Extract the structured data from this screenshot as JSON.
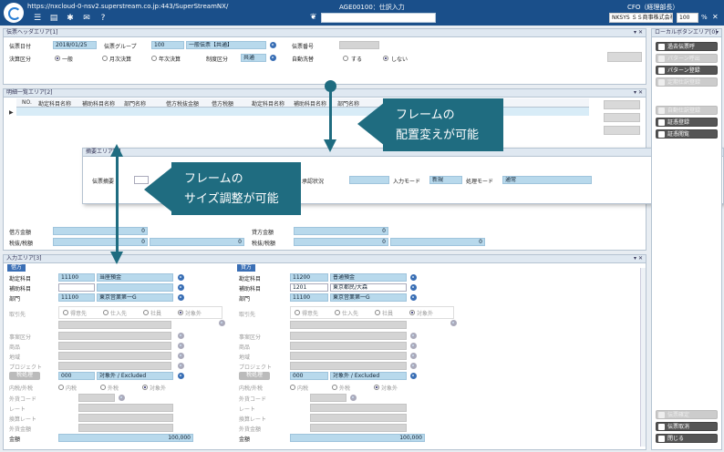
{
  "topbar": {
    "url": "https://nxcloud-0-nsv2.superstream.co.jp:443/SuperStreamNX/",
    "screen_title": "AGE00100：仕訳入力",
    "cfo": "CFO（経理部長）",
    "company": "NKSYS ＳＳ商事株式会社",
    "zoom": "100",
    "pct": "%"
  },
  "header_panel": {
    "title": "伝票ヘッダエリア[1]",
    "date_label": "伝票日付",
    "date_value": "2018/01/25",
    "group_label": "伝票グループ",
    "group_code": "100",
    "group_name": "一般伝票【共通】",
    "slip_no_label": "伝票番号",
    "settle_label": "決算区分",
    "settle_opt1": "一般",
    "settle_opt2": "月次決算",
    "settle_opt3": "年次決算",
    "system_label": "制度区分",
    "system_value": "共通",
    "auto_label": "自動洗替",
    "auto_yes": "する",
    "auto_no": "しない"
  },
  "detail_panel": {
    "title": "明細一覧エリア[2]",
    "columns": [
      "NO.",
      "勘定科目名称",
      "補助科目名称",
      "部門名称",
      "借方税抜金額",
      "借方税額",
      "勘定科目名称",
      "補助科目名称",
      "部門名称"
    ],
    "debit_total_label": "借方金額",
    "debit_total": "0",
    "debit_tax_label": "税抜/税額",
    "debit_tax1": "0",
    "debit_tax2": "0",
    "credit_total_label": "貸方金額",
    "credit_total": "0",
    "credit_tax_label": "税抜/税額",
    "credit_tax1": "0",
    "credit_tax2": "0"
  },
  "summary_panel": {
    "title": "摘要エリア[4]",
    "memo_label": "伝票摘要",
    "approval_label": "承認状況",
    "mode_label": "入力モード",
    "mode_value": "新規",
    "proc_label": "処理モード",
    "proc_value": "通常"
  },
  "input_panel": {
    "title": "入力エリア[3]",
    "debit": {
      "tag": "借方",
      "account_label": "勘定科目",
      "account_code": "11100",
      "account_name": "当座預金",
      "sub_label": "補助科目",
      "dept_label": "部門",
      "dept_code": "11100",
      "dept_name": "東京営業第一G",
      "partner_label": "取引先",
      "p_opt1": "得意先",
      "p_opt2": "仕入先",
      "p_opt3": "社員",
      "p_opt4": "対象外",
      "case_label": "事案区分",
      "product_label": "商品",
      "region_label": "地域",
      "project_label": "プロジェクト",
      "tax_btn": "税処理",
      "tax_code": "000",
      "tax_name": "対象外 / Excluded",
      "inout_label": "内税/外税",
      "io_opt1": "内税",
      "io_opt2": "外税",
      "io_opt3": "対象外",
      "fx_label": "外貨コード",
      "rate_label": "レート",
      "base_rate_label": "換算レート",
      "fx_amt_label": "外貨金額",
      "amount_label": "金額",
      "amount_value": "100,000"
    },
    "credit": {
      "tag": "貸方",
      "account_label": "勘定科目",
      "account_code": "11200",
      "account_name": "普通預金",
      "sub_label": "補助科目",
      "sub_code": "1201",
      "sub_name": "東京都民/大森",
      "dept_label": "部門",
      "dept_code": "11100",
      "dept_name": "東京営業第一G",
      "partner_label": "取引先",
      "p_opt1": "得意先",
      "p_opt2": "仕入先",
      "p_opt3": "社員",
      "p_opt4": "対象外",
      "case_label": "事案区分",
      "product_label": "商品",
      "region_label": "地域",
      "project_label": "プロジェクト",
      "tax_btn": "税処理",
      "tax_code": "000",
      "tax_name": "対象外 / Excluded",
      "inout_label": "内税/外税",
      "io_opt1": "内税",
      "io_opt2": "外税",
      "io_opt3": "対象外",
      "fx_label": "外貨コード",
      "rate_label": "レート",
      "base_rate_label": "換算レート",
      "fx_amt_label": "外貨金額",
      "amount_label": "金額",
      "amount_value": "100,000"
    }
  },
  "right_panel": {
    "title": "ローカルボタンエリア[0]",
    "btn_past": "過去伝票呼",
    "btn_pattern_call": "パターン呼出",
    "btn_pattern_reg": "パターン登録",
    "btn_periodic": "定期仕訳登録",
    "btn_auto": "自動仕訳登録",
    "btn_voucher": "証憑登録",
    "btn_voucher_use": "証憑閲覧",
    "btn_confirm": "伝票確定",
    "btn_cancel": "伝票取消",
    "btn_close": "閉じる"
  },
  "callouts": {
    "move_line1": "フレームの",
    "move_line2": "配置変えが可能",
    "resize_line1": "フレームの",
    "resize_line2": "サイズ調整が可能"
  }
}
